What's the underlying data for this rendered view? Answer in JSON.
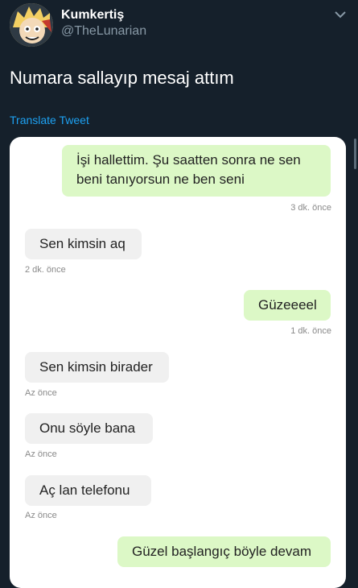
{
  "tweet": {
    "display_name": "Kumkertiş",
    "handle": "@TheLunarian",
    "text": "Numara sallayıp mesaj attım",
    "translate_label": "Translate Tweet"
  },
  "chat": {
    "messages": [
      {
        "direction": "sent",
        "text_line1": "İşi hallettim. Şu saatten sonra ne sen",
        "text_line2": "beni tanıyorsun ne ben seni",
        "time": "3 dk. önce"
      },
      {
        "direction": "received",
        "text": "Sen kimsin aq",
        "time": "2 dk. önce"
      },
      {
        "direction": "sent",
        "text": "Güzeeeel",
        "time": "1 dk. önce"
      },
      {
        "direction": "received",
        "text": "Sen kimsin birader",
        "time": "Az önce"
      },
      {
        "direction": "received",
        "text": "Onu söyle bana",
        "time": "Az önce"
      },
      {
        "direction": "received",
        "text": "Aç lan telefonu",
        "time": "Az önce"
      },
      {
        "direction": "sent",
        "text": "Güzel başlangıç böyle devam",
        "time": ""
      }
    ]
  },
  "colors": {
    "background": "#15202b",
    "link": "#1da1f2",
    "sent_bubble": "#dcf8c6",
    "received_bubble": "#f0f0f0"
  }
}
